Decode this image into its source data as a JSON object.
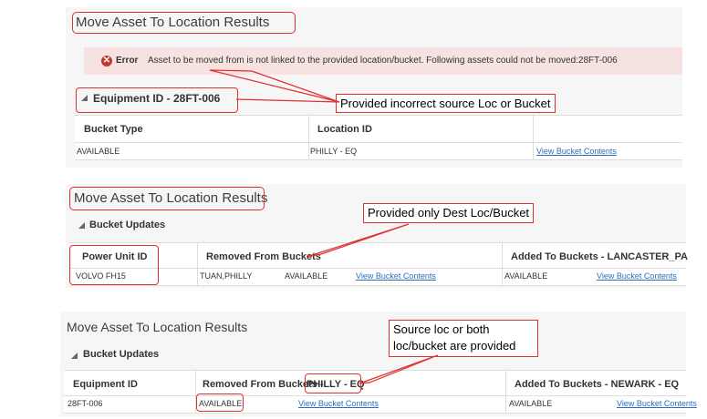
{
  "section1": {
    "title": "Move Asset To Location Results",
    "error": {
      "label": "Error",
      "message": "Asset to be moved from is not linked to the provided location/bucket. Following assets could not be moved:28FT-006"
    },
    "group_header": "Equipment ID - 28FT-006",
    "columns": [
      "Bucket Type",
      "Location ID"
    ],
    "row": {
      "bucket_type": "AVAILABLE",
      "location_id": "PHILLY - EQ",
      "link": "View Bucket Contents"
    },
    "callout": "Provided incorrect source Loc or Bucket"
  },
  "section2": {
    "title": "Move Asset To Location Results",
    "subheader": "Bucket Updates",
    "columns": [
      "Power Unit ID",
      "Removed From Buckets",
      "Added To Buckets - LANCASTER_PA"
    ],
    "row": {
      "id": "VOLVO FH15",
      "removed_location": "TUAN,PHILLY",
      "removed_type": "AVAILABLE",
      "removed_link": "View Bucket Contents",
      "added_type": "AVAILABLE",
      "added_link": "View Bucket Contents"
    },
    "callout": "Provided only Dest Loc/Bucket"
  },
  "section3": {
    "title": "Move Asset To Location Results",
    "subheader": "Bucket Updates",
    "columns": {
      "c1": "Equipment ID",
      "c2_prefix": "Removed From Buckets - ",
      "c2_highlight": "PHILLY - EQ",
      "c3": "Added To Buckets - NEWARK - EQ"
    },
    "row": {
      "id": "28FT-006",
      "removed_type": "AVAILABLE",
      "removed_link": "View Bucket Contents",
      "added_type": "AVAILABLE",
      "added_link": "View Bucket Contents"
    },
    "callout_line1": "Source loc or both",
    "callout_line2": "loc/bucket are provided"
  },
  "colors": {
    "annotation_red": "#e03030",
    "link_blue": "#2a6ebb",
    "error_bg": "#f6e2e0",
    "panel_bg": "#f6f6f6"
  },
  "icons": {
    "error": "error-circle-icon",
    "collapse": "collapse-triangle-icon"
  }
}
